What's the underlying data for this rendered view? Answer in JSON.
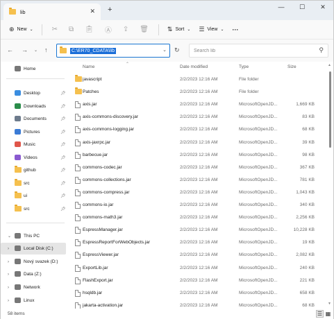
{
  "tab": {
    "title": "lib",
    "close": "✕",
    "new_tab": "+"
  },
  "window_controls": {
    "minimize": "—",
    "maximize": "☐",
    "close": "✕"
  },
  "commandbar": {
    "new_label": "New",
    "sort_label": "Sort",
    "view_label": "View",
    "more": "···"
  },
  "address": {
    "path": "C:\\ER70_CDATA\\lib",
    "search_placeholder": "Search lib"
  },
  "sidebar": {
    "home": "Home",
    "quick_access": [
      {
        "label": "Desktop",
        "icon": "desktop-icon"
      },
      {
        "label": "Downloads",
        "icon": "download-icon"
      },
      {
        "label": "Documents",
        "icon": "documents-icon"
      },
      {
        "label": "Pictures",
        "icon": "pictures-icon"
      },
      {
        "label": "Music",
        "icon": "music-icon"
      },
      {
        "label": "Videos",
        "icon": "videos-icon"
      },
      {
        "label": "github",
        "icon": "folder-icon"
      },
      {
        "label": "src",
        "icon": "folder-icon"
      },
      {
        "label": "ui",
        "icon": "folder-icon"
      },
      {
        "label": "src",
        "icon": "folder-icon"
      }
    ],
    "this_pc": "This PC",
    "drives": [
      {
        "label": "Local Disk (C:)"
      },
      {
        "label": "Nový svazek (D:)"
      },
      {
        "label": "Data (Z:)"
      }
    ],
    "network": "Network",
    "linux": "Linux"
  },
  "columns": {
    "name": "Name",
    "date": "Date modified",
    "type": "Type",
    "size": "Size"
  },
  "files": [
    {
      "name": "javascript",
      "date": "2/2/2023 12:16 AM",
      "type": "File folder",
      "size": "",
      "kind": "folder"
    },
    {
      "name": "Patches",
      "date": "2/2/2023 12:16 AM",
      "type": "File folder",
      "size": "",
      "kind": "folder"
    },
    {
      "name": "axis.jar",
      "date": "2/2/2023 12:16 AM",
      "type": "MicrosoftOpenJD...",
      "size": "1,669 KB",
      "kind": "file"
    },
    {
      "name": "axis-commons-discovery.jar",
      "date": "2/2/2023 12:16 AM",
      "type": "MicrosoftOpenJD...",
      "size": "83 KB",
      "kind": "file"
    },
    {
      "name": "axis-commons-logging.jar",
      "date": "2/2/2023 12:16 AM",
      "type": "MicrosoftOpenJD...",
      "size": "68 KB",
      "kind": "file"
    },
    {
      "name": "axis-jaxrpc.jar",
      "date": "2/2/2023 12:16 AM",
      "type": "MicrosoftOpenJD...",
      "size": "39 KB",
      "kind": "file"
    },
    {
      "name": "barbecue.jar",
      "date": "2/2/2023 12:16 AM",
      "type": "MicrosoftOpenJD...",
      "size": "98 KB",
      "kind": "file"
    },
    {
      "name": "commons-codec.jar",
      "date": "2/2/2023 12:16 AM",
      "type": "MicrosoftOpenJD...",
      "size": "367 KB",
      "kind": "file"
    },
    {
      "name": "commons-collections.jar",
      "date": "2/2/2023 12:16 AM",
      "type": "MicrosoftOpenJD...",
      "size": "781 KB",
      "kind": "file"
    },
    {
      "name": "commons-compress.jar",
      "date": "2/2/2023 12:16 AM",
      "type": "MicrosoftOpenJD...",
      "size": "1,043 KB",
      "kind": "file"
    },
    {
      "name": "commons-io.jar",
      "date": "2/2/2023 12:16 AM",
      "type": "MicrosoftOpenJD...",
      "size": "340 KB",
      "kind": "file"
    },
    {
      "name": "commons-math3.jar",
      "date": "2/2/2023 12:16 AM",
      "type": "MicrosoftOpenJD...",
      "size": "2,256 KB",
      "kind": "file"
    },
    {
      "name": "EspressManager.jar",
      "date": "2/2/2023 12:16 AM",
      "type": "MicrosoftOpenJD...",
      "size": "10,228 KB",
      "kind": "file"
    },
    {
      "name": "EspressReportForWebObjects.jar",
      "date": "2/2/2023 12:16 AM",
      "type": "MicrosoftOpenJD...",
      "size": "19 KB",
      "kind": "file"
    },
    {
      "name": "EspressViewer.jar",
      "date": "2/2/2023 12:16 AM",
      "type": "MicrosoftOpenJD...",
      "size": "2,082 KB",
      "kind": "file"
    },
    {
      "name": "ExportLib.jar",
      "date": "2/2/2023 12:16 AM",
      "type": "MicrosoftOpenJD...",
      "size": "240 KB",
      "kind": "file"
    },
    {
      "name": "FlashExport.jar",
      "date": "2/2/2023 12:16 AM",
      "type": "MicrosoftOpenJD...",
      "size": "221 KB",
      "kind": "file"
    },
    {
      "name": "hsqldb.jar",
      "date": "2/2/2023 12:16 AM",
      "type": "MicrosoftOpenJD...",
      "size": "658 KB",
      "kind": "file"
    },
    {
      "name": "jakarta-activation.jar",
      "date": "2/2/2023 12:16 AM",
      "type": "MicrosoftOpenJD...",
      "size": "68 KB",
      "kind": "file"
    }
  ],
  "status": {
    "count": "58 items"
  }
}
